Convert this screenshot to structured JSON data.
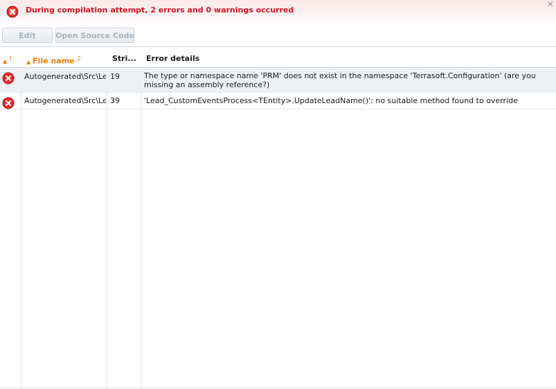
{
  "banner": {
    "icon": "error-circle-icon",
    "title": "During compilation attempt, 2 errors and 0 warnings occurred",
    "close_glyph": "✕",
    "accent_color": "#d8121c"
  },
  "toolbar": {
    "edit_label": "Edit",
    "open_source_label": "Open Source Code"
  },
  "grid": {
    "columns": {
      "sort_label": "1",
      "file_label": "File name",
      "file_sort_index": "2",
      "string_label": "Stri...",
      "error_label": "Error details"
    },
    "rows": [
      {
        "icon": "error-circle-icon",
        "file": "Autogenerated\\Src\\Lead_CustomEventsProcess.cs",
        "string": "19",
        "error": "The type or namespace name 'PRM' does not exist in the namespace 'Terrasoft.Configuration' (are you missing an assembly reference?)"
      },
      {
        "icon": "error-circle-icon",
        "file": "Autogenerated\\Src\\Lead_CustomEventsProcess.cs",
        "string": "39",
        "error": "'Lead_CustomEventsProcess<TEntity>.UpdateLeadName()': no suitable method found to override"
      }
    ]
  }
}
